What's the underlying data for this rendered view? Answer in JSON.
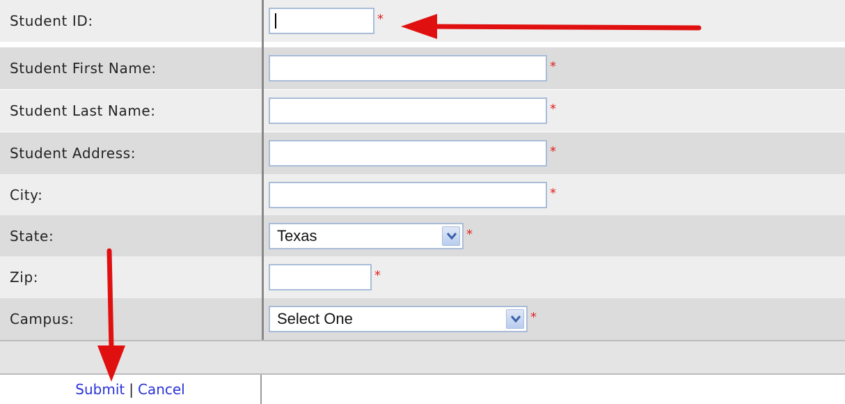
{
  "fields": [
    {
      "label": "Student ID:",
      "type": "text",
      "value": "",
      "focused": true
    },
    {
      "label": "Student First Name:",
      "type": "text",
      "value": ""
    },
    {
      "label": "Student Last Name:",
      "type": "text",
      "value": ""
    },
    {
      "label": "Student Address:",
      "type": "text",
      "value": ""
    },
    {
      "label": "City:",
      "type": "text",
      "value": ""
    },
    {
      "label": "State:",
      "type": "select",
      "value": "Texas"
    },
    {
      "label": "Zip:",
      "type": "text",
      "value": ""
    },
    {
      "label": "Campus:",
      "type": "select",
      "value": "Select One"
    }
  ],
  "required_marker": "*",
  "actions": {
    "submit": "Submit",
    "separator": "|",
    "cancel": "Cancel"
  },
  "colors": {
    "required": "#e02020",
    "link": "#2a32d8",
    "annotation_arrow": "#e01010"
  }
}
